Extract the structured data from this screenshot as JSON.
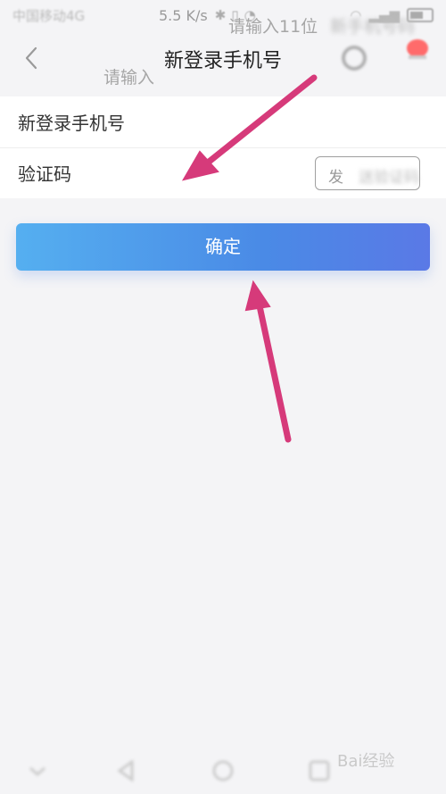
{
  "status_bar": {
    "carrier": "中国移动4G",
    "speed": "5.5 K/s"
  },
  "navbar": {
    "title": "新登录手机号"
  },
  "form": {
    "phone_label": "新登录手机号",
    "phone_placeholder": "请输入11位",
    "phone_placeholder_tail": "新手机号码",
    "code_label": "验证码",
    "code_placeholder": "请输入",
    "send_code_button": "发",
    "send_code_button_tail": "送验证码"
  },
  "confirm_button": "确定",
  "watermark": "Bai经验",
  "colors": {
    "page_bg": "#f4f4f6",
    "button_gradient_start": "#55aff0",
    "button_gradient_end": "#5a79e6",
    "annotation_arrow": "#d63a7a"
  }
}
